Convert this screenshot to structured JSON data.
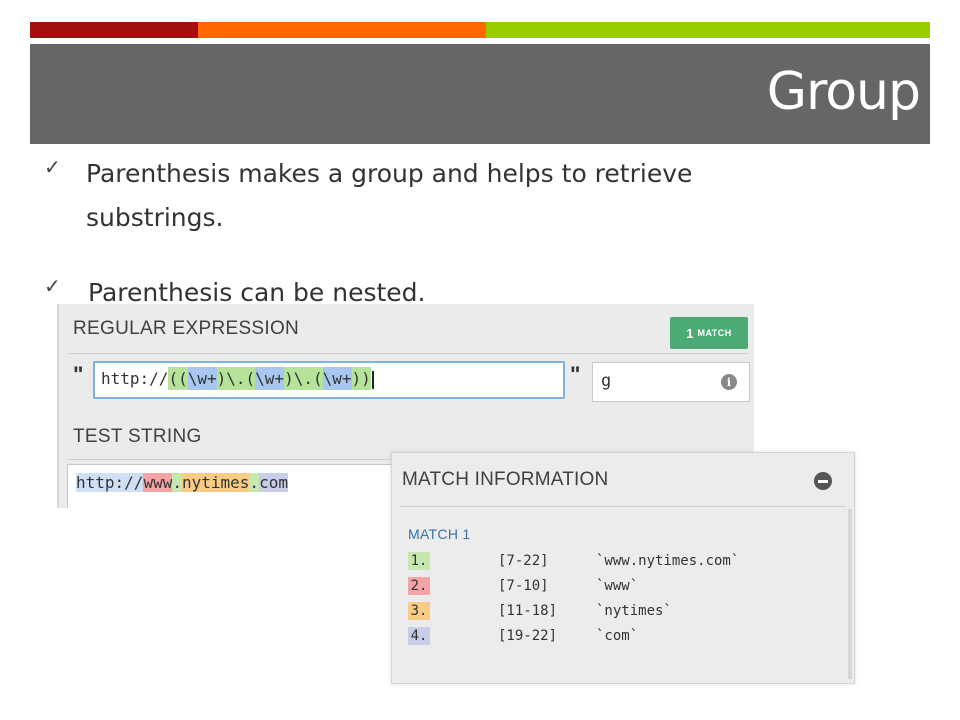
{
  "slide": {
    "title": "Group",
    "colors": {
      "bar_red": "#a30e0e",
      "bar_orange": "#ff6a00",
      "bar_green": "#99cc00",
      "banner_bg": "#666666"
    }
  },
  "bullets": [
    {
      "icon": "checkmark-icon",
      "text": "Parenthesis makes a group and helps to retrieve substrings."
    },
    {
      "icon": "checkmark-icon",
      "text": "Parenthesis can be nested."
    }
  ],
  "regex_panel": {
    "header": "REGULAR EXPRESSION",
    "match_count": "1",
    "match_word": "MATCH",
    "quote_open": "\"",
    "quote_close": "\"",
    "regex": {
      "prefix": "http://",
      "g_open": "((",
      "g1": "\\w+",
      "close1": ")",
      "sep1": "\\.",
      "open2": "(",
      "g2": "\\w+",
      "close2": ")",
      "sep2": "\\.",
      "open3": "(",
      "g3": "\\w+",
      "g_close": "))"
    },
    "flags": "g",
    "info_icon_glyph": "i",
    "test_string_header": "TEST STRING",
    "test_string": {
      "prefix": "http://",
      "part1": "www",
      "dot1": ".",
      "part2": "nytimes",
      "dot2": ".",
      "part3": "com"
    }
  },
  "match_info": {
    "header": "MATCH INFORMATION",
    "match_label": "MATCH 1",
    "groups": [
      {
        "num": "1.",
        "range": "[7-22]",
        "value": "`www.nytimes.com`",
        "color": "#c6e8b0"
      },
      {
        "num": "2.",
        "range": "[7-10]",
        "value": "`www`",
        "color": "#f4a4a4"
      },
      {
        "num": "3.",
        "range": "[11-18]",
        "value": "`nytimes`",
        "color": "#f9cc85"
      },
      {
        "num": "4.",
        "range": "[19-22]",
        "value": "`com`",
        "color": "#c8cde9"
      }
    ]
  }
}
